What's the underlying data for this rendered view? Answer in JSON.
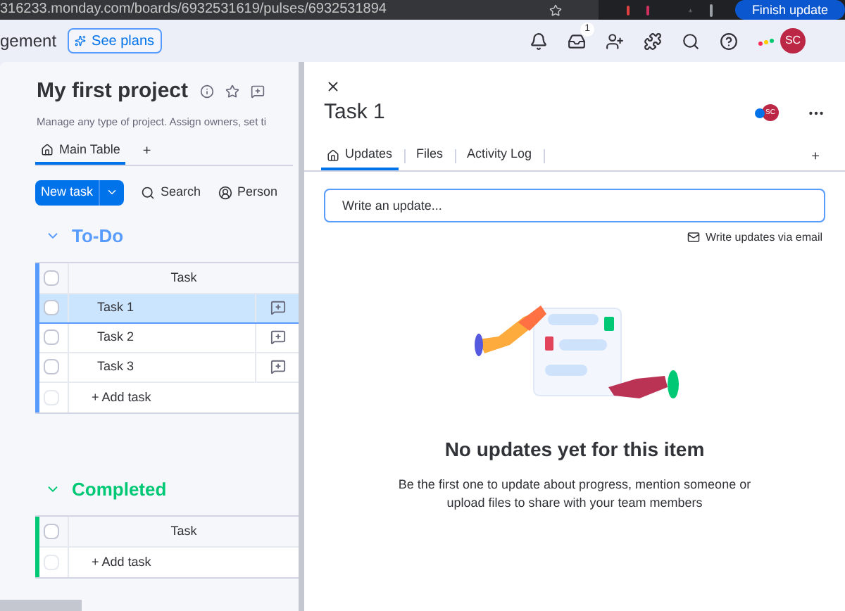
{
  "browser": {
    "url": "316233.monday.com/boards/6932531619/pulses/6932531894",
    "finish_button": "Finish update"
  },
  "topbar": {
    "workspace_text": "gement",
    "see_plans": "See plans",
    "inbox_badge": "1",
    "avatar": "SC"
  },
  "board": {
    "title": "My first project",
    "description": "Manage any type of project. Assign owners, set ti",
    "tabs": [
      {
        "label": "Main Table",
        "selected": true
      }
    ],
    "add_tab": "+",
    "toolbar": {
      "new_task": "New task",
      "search": "Search",
      "person": "Person"
    },
    "groups": [
      {
        "name": "To-Do",
        "color": "#579bfc",
        "column": "Task",
        "header_checked": false,
        "add_row": "+ Add task",
        "add_row_checked": false,
        "rows": [
          {
            "name": "Task 1",
            "selected": true,
            "checked": false
          },
          {
            "name": "Task 2",
            "selected": false,
            "checked": false
          },
          {
            "name": "Task 3",
            "selected": false,
            "checked": false
          }
        ]
      },
      {
        "name": "Completed",
        "color": "#00c875",
        "column": "Task",
        "header_checked": false,
        "add_row": "+ Add task",
        "add_row_checked": false
      }
    ]
  },
  "panel": {
    "title": "Task 1",
    "avatar": "SC",
    "tabs": [
      {
        "label": "Updates",
        "selected": true
      },
      {
        "label": "Files",
        "selected": false
      },
      {
        "label": "Activity Log",
        "selected": false
      }
    ],
    "add_tab": "+",
    "update_placeholder": "Write an update...",
    "email_link": "Write updates via email",
    "empty_title": "No updates yet for this item",
    "empty_text": "Be the first one to update about progress, mention someone or upload files to share with your team members"
  }
}
